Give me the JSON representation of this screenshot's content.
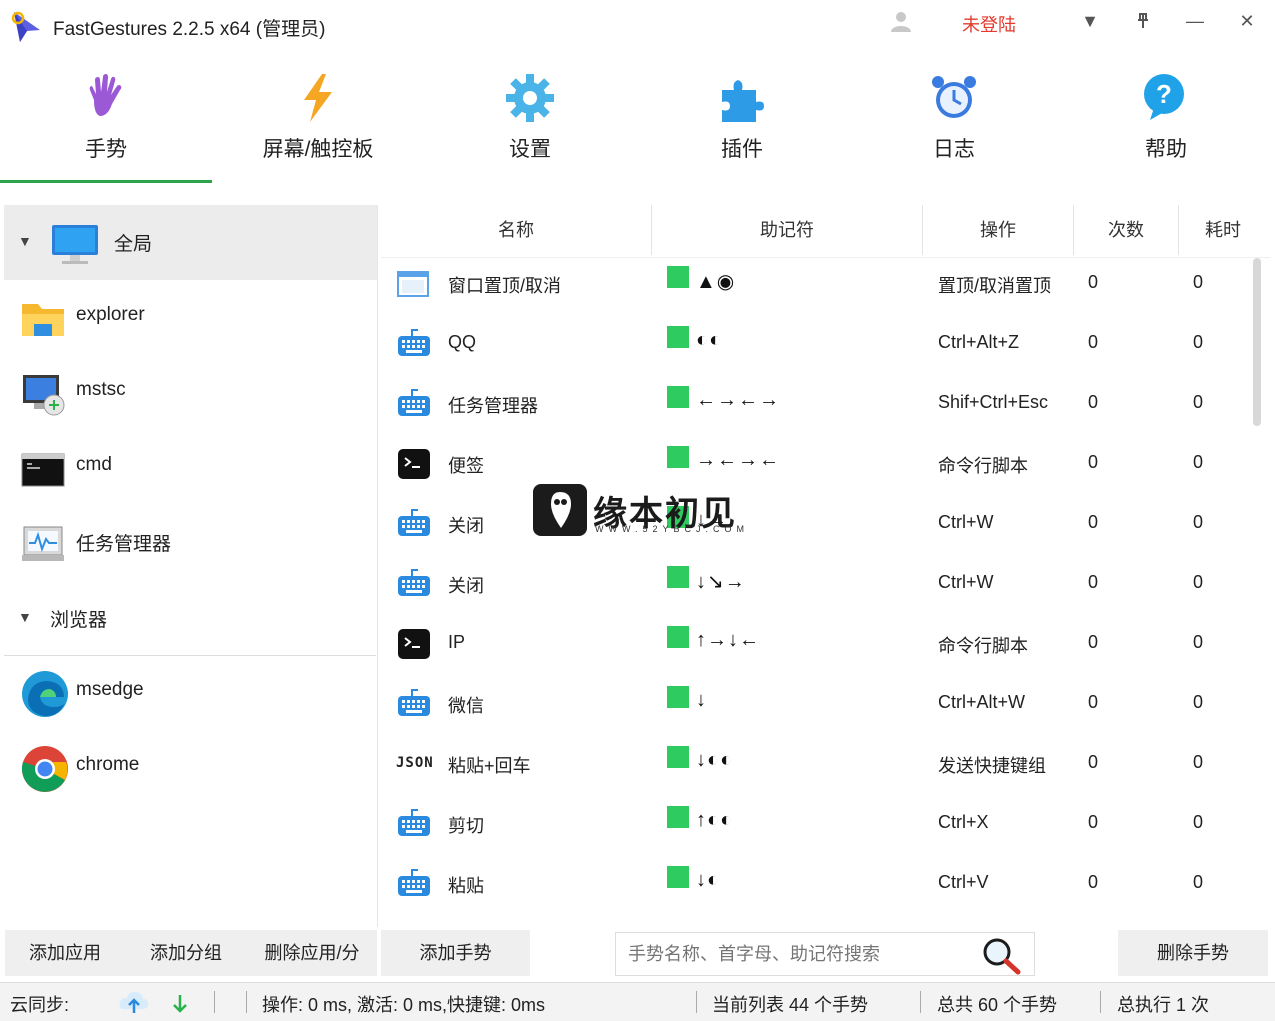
{
  "window": {
    "title": "FastGestures 2.2.5 x64  (管理员)",
    "login_text": "未登陆",
    "dropdown_glyph": "▼",
    "pin_glyph": "⊼",
    "minimize_glyph": "—",
    "close_glyph": "✕"
  },
  "nav": {
    "tabs": [
      {
        "label": "手势",
        "icon": "hand-icon",
        "active": true
      },
      {
        "label": "屏幕/触控板",
        "icon": "lightning-icon"
      },
      {
        "label": "设置",
        "icon": "gear-icon"
      },
      {
        "label": "插件",
        "icon": "puzzle-icon"
      },
      {
        "label": "日志",
        "icon": "alarm-clock-icon"
      },
      {
        "label": "帮助",
        "icon": "help-icon"
      }
    ]
  },
  "apps": {
    "items": [
      {
        "label": "全局",
        "icon": "monitor-icon",
        "selected": true
      },
      {
        "label": "explorer",
        "icon": "folder-icon"
      },
      {
        "label": "mstsc",
        "icon": "remote-desktop-icon"
      },
      {
        "label": "cmd",
        "icon": "console-icon"
      },
      {
        "label": "任务管理器",
        "icon": "task-manager-icon"
      },
      {
        "label": "浏览器",
        "icon": "group-arrow-icon"
      },
      {
        "label": "msedge",
        "icon": "edge-icon"
      },
      {
        "label": "chrome",
        "icon": "chrome-icon"
      }
    ],
    "expand_glyph": "▼"
  },
  "table": {
    "columns": [
      "名称",
      "助记符",
      "操作",
      "次数",
      "耗时"
    ],
    "rows": [
      {
        "name": "窗口置顶/取消",
        "icon": "window-icon",
        "mnemonic": "▲◉",
        "action": "置顶/取消置顶",
        "count": "0",
        "time": "0"
      },
      {
        "name": "QQ",
        "icon": "keyboard-icon",
        "mnemonic": "◐◐",
        "action": "Ctrl+Alt+Z",
        "count": "0",
        "time": "0"
      },
      {
        "name": "任务管理器",
        "icon": "keyboard-icon",
        "mnemonic": "←→←→",
        "action": "Shif+Ctrl+Esc",
        "count": "0",
        "time": "0"
      },
      {
        "name": "便签",
        "icon": "terminal-icon",
        "mnemonic": "→←→←",
        "action": "命令行脚本",
        "count": "0",
        "time": "0"
      },
      {
        "name": "关闭",
        "icon": "keyboard-icon",
        "mnemonic": "↓→",
        "action": "Ctrl+W",
        "count": "0",
        "time": "0"
      },
      {
        "name": "关闭",
        "icon": "keyboard-icon",
        "mnemonic": "↓↘→",
        "action": "Ctrl+W",
        "count": "0",
        "time": "0"
      },
      {
        "name": "IP",
        "icon": "terminal-icon",
        "mnemonic": "↑→↓←",
        "action": "命令行脚本",
        "count": "0",
        "time": "0"
      },
      {
        "name": "微信",
        "icon": "keyboard-icon",
        "mnemonic": "↓",
        "action": "Ctrl+Alt+W",
        "count": "0",
        "time": "0"
      },
      {
        "name": "粘贴+回车",
        "icon": "json-icon",
        "icon_text": "JSON",
        "mnemonic": "↓◐◐",
        "action": "发送快捷键组",
        "count": "0",
        "time": "0"
      },
      {
        "name": "剪切",
        "icon": "keyboard-icon",
        "mnemonic": "↑◐◐",
        "action": "Ctrl+X",
        "count": "0",
        "time": "0"
      },
      {
        "name": "粘贴",
        "icon": "keyboard-icon",
        "mnemonic": "↓◐",
        "action": "Ctrl+V",
        "count": "0",
        "time": "0"
      }
    ]
  },
  "watermark": {
    "text": "缘本初见",
    "sub": "WWW.52YBCJ.COM"
  },
  "bottom": {
    "add_app": "添加应用",
    "add_group": "添加分组",
    "delete_app": "删除应用/分",
    "add_gesture": "添加手势",
    "search_placeholder": "手势名称、首字母、助记符搜索",
    "delete_gesture": "删除手势"
  },
  "status": {
    "cloud_sync": "云同步:",
    "timing": "操作: 0 ms, 激活: 0 ms,快捷键: 0ms",
    "list_count": "当前列表 44 个手势",
    "total": "总共 60 个手势",
    "executed": "总执行 1 次"
  },
  "colors": {
    "accent_green": "#2da44e",
    "gesture_green": "#2ecc60",
    "login_red": "#e23a2e",
    "keyboard_blue": "#2a8ae0"
  }
}
